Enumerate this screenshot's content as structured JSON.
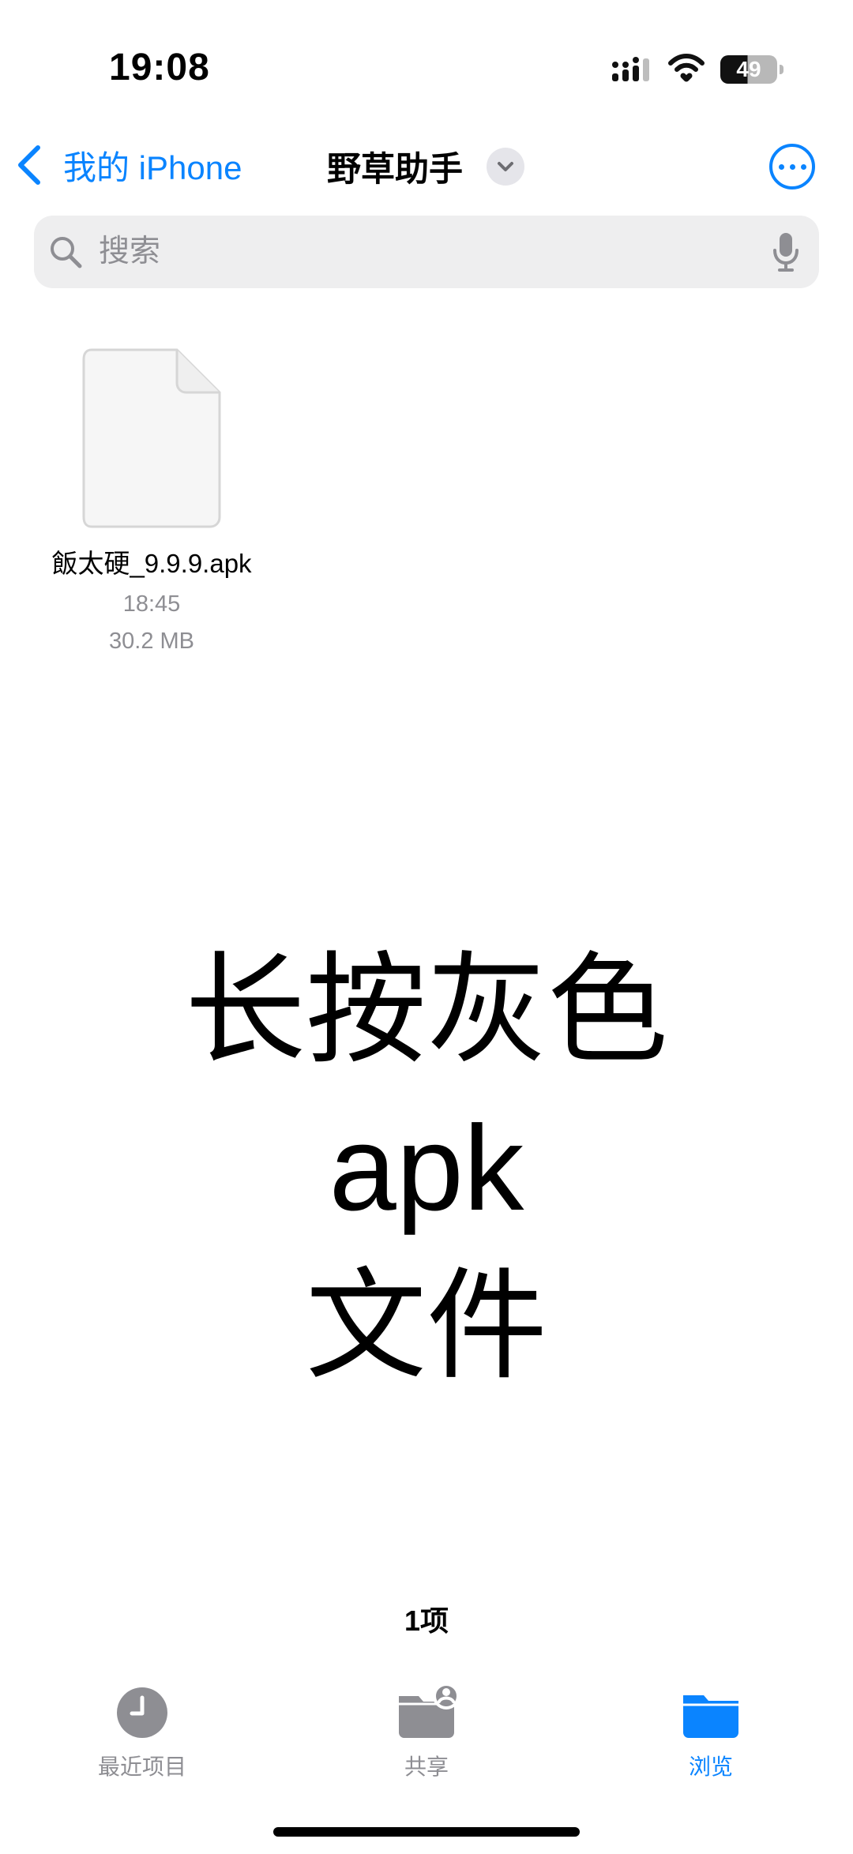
{
  "status_bar": {
    "time": "19:08",
    "battery": "49",
    "icons": [
      "cellular-signal-icon",
      "wifi-icon",
      "battery-icon"
    ]
  },
  "navigation": {
    "back_label": "我的 iPhone",
    "title": "野草助手",
    "icons": [
      "chevron-left-icon",
      "chevron-down-icon",
      "more-icon"
    ]
  },
  "search": {
    "placeholder": "搜索",
    "value": "",
    "icons": [
      "search-icon",
      "microphone-icon"
    ]
  },
  "files": [
    {
      "name": "飯太硬_9.9.9.apk",
      "time": "18:45",
      "size": "30.2 MB",
      "icon": "document-icon"
    }
  ],
  "overlay": {
    "line1": "长按灰色apk",
    "line2": "文件"
  },
  "footer": {
    "item_count": "1项"
  },
  "tabs": [
    {
      "label": "最近项目",
      "icon": "clock-icon",
      "selected": false
    },
    {
      "label": "共享",
      "icon": "shared-folder-icon",
      "selected": false
    },
    {
      "label": "浏览",
      "icon": "folder-icon",
      "selected": true
    }
  ],
  "colors": {
    "accent": "#0A84FF",
    "secondary_text": "#8E8E93",
    "search_background": "#EEEEEF"
  }
}
